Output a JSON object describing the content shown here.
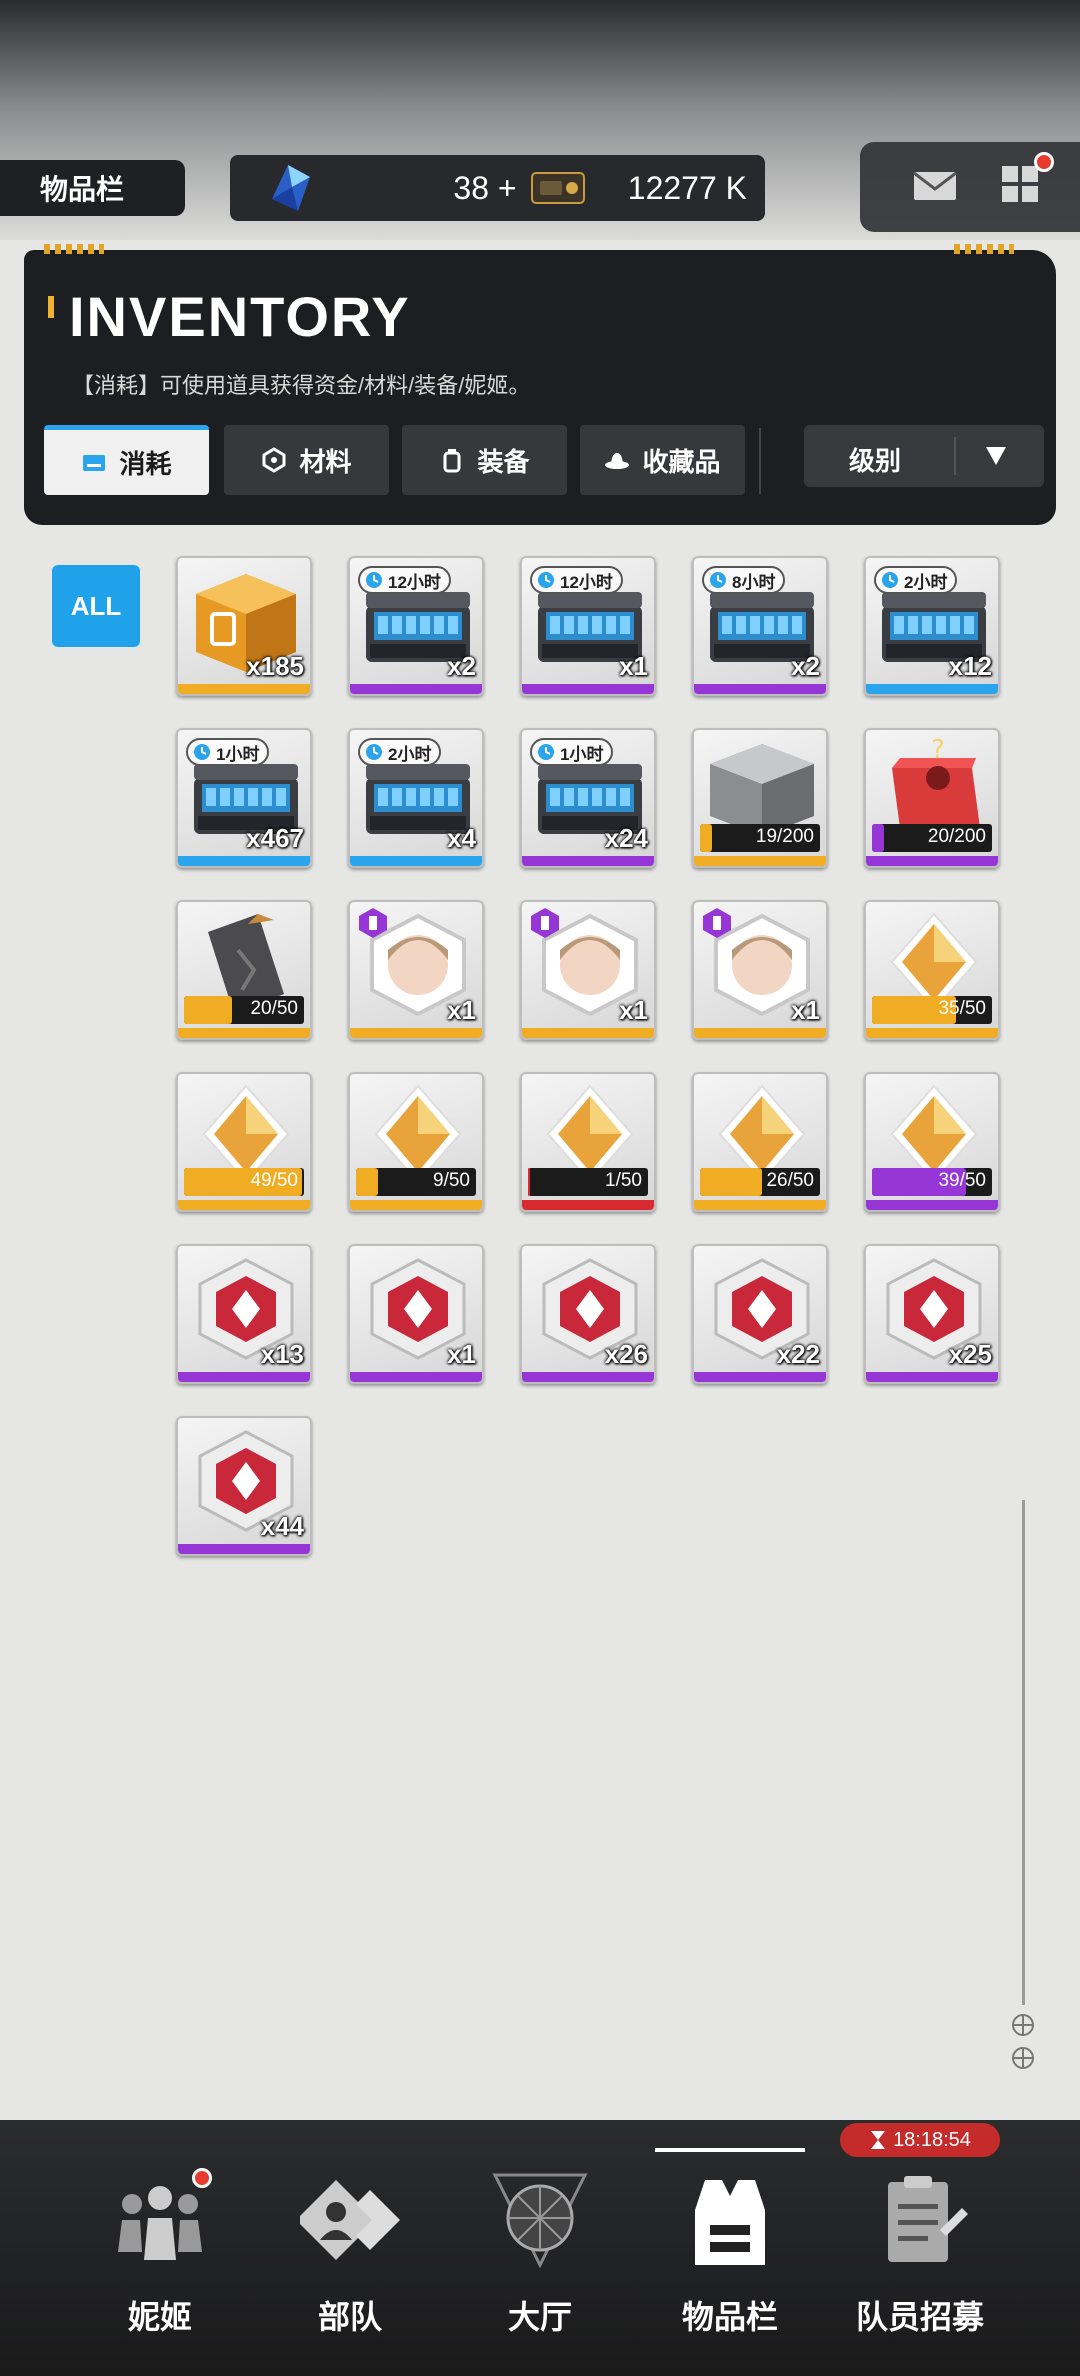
{
  "top_bar": {
    "page_tag": "物品栏",
    "gems": "38",
    "gems_plus": "+",
    "coins": "12277 K"
  },
  "inventory": {
    "title": "INVENTORY",
    "description": "【消耗】可使用道具获得资金/材料/装备/妮姬。",
    "tabs": [
      {
        "label": "消耗",
        "active": true
      },
      {
        "label": "材料",
        "active": false
      },
      {
        "label": "装备",
        "active": false
      },
      {
        "label": "收藏品",
        "active": false
      }
    ],
    "sort": {
      "label": "级别"
    }
  },
  "filter": {
    "all_label": "ALL"
  },
  "items": [
    {
      "type": "box",
      "qty": "x185",
      "rarity": "gold"
    },
    {
      "type": "case",
      "time": "12小时",
      "qty": "x2",
      "rarity": "purple"
    },
    {
      "type": "case",
      "time": "12小时",
      "qty": "x1",
      "rarity": "purple"
    },
    {
      "type": "case",
      "time": "8小时",
      "qty": "x2",
      "rarity": "purple"
    },
    {
      "type": "case",
      "time": "2小时",
      "qty": "x12",
      "rarity": "blue"
    },
    {
      "type": "case",
      "time": "1小时",
      "qty": "x467",
      "rarity": "blue"
    },
    {
      "type": "case",
      "time": "2小时",
      "qty": "x4",
      "rarity": "blue"
    },
    {
      "type": "case",
      "time": "1小时",
      "qty": "x24",
      "rarity": "purple"
    },
    {
      "type": "crate",
      "progress": "19/200",
      "fill": 0.095,
      "rarity": "gold"
    },
    {
      "type": "lucky",
      "progress": "20/200",
      "fill": 0.1,
      "rarity": "purple"
    },
    {
      "type": "card",
      "progress": "20/50",
      "fill": 0.4,
      "rarity": "gold"
    },
    {
      "type": "portrait",
      "qty": "x1",
      "rarity": "gold"
    },
    {
      "type": "portrait",
      "qty": "x1",
      "rarity": "gold"
    },
    {
      "type": "portrait",
      "qty": "x1",
      "rarity": "gold"
    },
    {
      "type": "shard",
      "progress": "35/50",
      "fill": 0.7,
      "rarity": "gold"
    },
    {
      "type": "shard",
      "progress": "49/50",
      "fill": 0.98,
      "rarity": "gold"
    },
    {
      "type": "shard",
      "progress": "9/50",
      "fill": 0.18,
      "rarity": "gold"
    },
    {
      "type": "shard",
      "progress": "1/50",
      "fill": 0.02,
      "rarity": "red"
    },
    {
      "type": "shard",
      "progress": "26/50",
      "fill": 0.52,
      "rarity": "gold"
    },
    {
      "type": "shard",
      "progress": "39/50",
      "fill": 0.78,
      "rarity": "purple"
    },
    {
      "type": "hex",
      "qty": "x13",
      "rarity": "purple"
    },
    {
      "type": "hex",
      "qty": "x1",
      "rarity": "purple"
    },
    {
      "type": "hex",
      "qty": "x26",
      "rarity": "purple"
    },
    {
      "type": "hex",
      "qty": "x22",
      "rarity": "purple"
    },
    {
      "type": "hex",
      "qty": "x25",
      "rarity": "purple"
    },
    {
      "type": "hex",
      "qty": "x44",
      "rarity": "purple"
    }
  ],
  "bottom_nav": {
    "items": [
      {
        "label": "妮姬"
      },
      {
        "label": "部队"
      },
      {
        "label": "大厅"
      },
      {
        "label": "物品栏"
      },
      {
        "label": "队员招募"
      }
    ],
    "timer": "18:18:54"
  },
  "colors": {
    "accent": "#2aa4ec",
    "gold": "#f0ac22",
    "purple": "#9736d6",
    "red": "#d92a2f"
  }
}
